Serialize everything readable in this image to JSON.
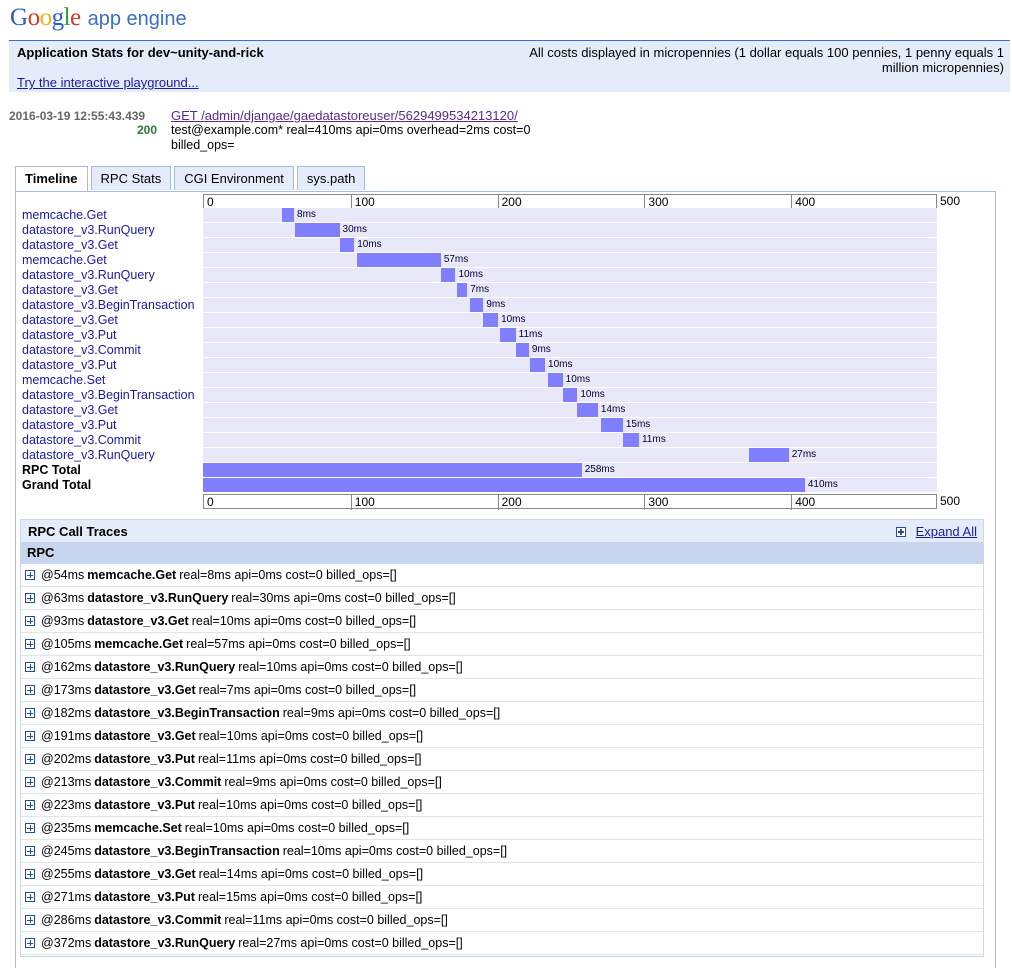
{
  "brand": {
    "google": [
      "G",
      "o",
      "o",
      "g",
      "l",
      "e"
    ],
    "product": "app engine"
  },
  "header": {
    "title": "Application Stats for dev~unity-and-rick",
    "cost_note": "All costs displayed in micropennies (1 dollar equals 100 pennies, 1 penny equals 1 million micropennies)",
    "playground_link": "Try the interactive playground..."
  },
  "request": {
    "timestamp": "2016-03-19 12:55:43.439",
    "status": "200",
    "link": "GET /admin/djangae/gaedatastoreuser/5629499534213120/",
    "details": "test@example.com* real=410ms api=0ms overhead=2ms cost=0 billed_ops="
  },
  "tabs": [
    "Timeline",
    "RPC Stats",
    "CGI Environment",
    "sys.path"
  ],
  "active_tab": 0,
  "timeline": {
    "scale_max": 500,
    "ticks": [
      "0",
      "100",
      "200",
      "300",
      "400"
    ],
    "end_label": "500",
    "rows": [
      {
        "name": "memcache.Get",
        "start": 54,
        "dur": 8,
        "label": "8ms"
      },
      {
        "name": "datastore_v3.RunQuery",
        "start": 63,
        "dur": 30,
        "label": "30ms"
      },
      {
        "name": "datastore_v3.Get",
        "start": 93,
        "dur": 10,
        "label": "10ms"
      },
      {
        "name": "memcache.Get",
        "start": 105,
        "dur": 57,
        "label": "57ms"
      },
      {
        "name": "datastore_v3.RunQuery",
        "start": 162,
        "dur": 10,
        "label": "10ms"
      },
      {
        "name": "datastore_v3.Get",
        "start": 173,
        "dur": 7,
        "label": "7ms"
      },
      {
        "name": "datastore_v3.BeginTransaction",
        "start": 182,
        "dur": 9,
        "label": "9ms"
      },
      {
        "name": "datastore_v3.Get",
        "start": 191,
        "dur": 10,
        "label": "10ms"
      },
      {
        "name": "datastore_v3.Put",
        "start": 202,
        "dur": 11,
        "label": "11ms"
      },
      {
        "name": "datastore_v3.Commit",
        "start": 213,
        "dur": 9,
        "label": "9ms"
      },
      {
        "name": "datastore_v3.Put",
        "start": 223,
        "dur": 10,
        "label": "10ms"
      },
      {
        "name": "memcache.Set",
        "start": 235,
        "dur": 10,
        "label": "10ms"
      },
      {
        "name": "datastore_v3.BeginTransaction",
        "start": 245,
        "dur": 10,
        "label": "10ms"
      },
      {
        "name": "datastore_v3.Get",
        "start": 255,
        "dur": 14,
        "label": "14ms"
      },
      {
        "name": "datastore_v3.Put",
        "start": 271,
        "dur": 15,
        "label": "15ms"
      },
      {
        "name": "datastore_v3.Commit",
        "start": 286,
        "dur": 11,
        "label": "11ms"
      },
      {
        "name": "datastore_v3.RunQuery",
        "start": 372,
        "dur": 27,
        "label": "27ms"
      }
    ],
    "totals": [
      {
        "name": "RPC Total",
        "start": 0,
        "dur": 258,
        "label": "258ms"
      },
      {
        "name": "Grand Total",
        "start": 0,
        "dur": 410,
        "label": "410ms"
      }
    ]
  },
  "traces": {
    "title": "RPC Call Traces",
    "expand_all": "Expand All",
    "column": "RPC",
    "rows": [
      {
        "at": "@54ms",
        "name": "memcache.Get",
        "stats": "real=8ms api=0ms cost=0 billed_ops=[]"
      },
      {
        "at": "@63ms",
        "name": "datastore_v3.RunQuery",
        "stats": "real=30ms api=0ms cost=0 billed_ops=[]"
      },
      {
        "at": "@93ms",
        "name": "datastore_v3.Get",
        "stats": "real=10ms api=0ms cost=0 billed_ops=[]"
      },
      {
        "at": "@105ms",
        "name": "memcache.Get",
        "stats": "real=57ms api=0ms cost=0 billed_ops=[]"
      },
      {
        "at": "@162ms",
        "name": "datastore_v3.RunQuery",
        "stats": "real=10ms api=0ms cost=0 billed_ops=[]"
      },
      {
        "at": "@173ms",
        "name": "datastore_v3.Get",
        "stats": "real=7ms api=0ms cost=0 billed_ops=[]"
      },
      {
        "at": "@182ms",
        "name": "datastore_v3.BeginTransaction",
        "stats": "real=9ms api=0ms cost=0 billed_ops=[]"
      },
      {
        "at": "@191ms",
        "name": "datastore_v3.Get",
        "stats": "real=10ms api=0ms cost=0 billed_ops=[]"
      },
      {
        "at": "@202ms",
        "name": "datastore_v3.Put",
        "stats": "real=11ms api=0ms cost=0 billed_ops=[]"
      },
      {
        "at": "@213ms",
        "name": "datastore_v3.Commit",
        "stats": "real=9ms api=0ms cost=0 billed_ops=[]"
      },
      {
        "at": "@223ms",
        "name": "datastore_v3.Put",
        "stats": "real=10ms api=0ms cost=0 billed_ops=[]"
      },
      {
        "at": "@235ms",
        "name": "memcache.Set",
        "stats": "real=10ms api=0ms cost=0 billed_ops=[]"
      },
      {
        "at": "@245ms",
        "name": "datastore_v3.BeginTransaction",
        "stats": "real=10ms api=0ms cost=0 billed_ops=[]"
      },
      {
        "at": "@255ms",
        "name": "datastore_v3.Get",
        "stats": "real=14ms api=0ms cost=0 billed_ops=[]"
      },
      {
        "at": "@271ms",
        "name": "datastore_v3.Put",
        "stats": "real=15ms api=0ms cost=0 billed_ops=[]"
      },
      {
        "at": "@286ms",
        "name": "datastore_v3.Commit",
        "stats": "real=11ms api=0ms cost=0 billed_ops=[]"
      },
      {
        "at": "@372ms",
        "name": "datastore_v3.RunQuery",
        "stats": "real=27ms api=0ms cost=0 billed_ops=[]"
      }
    ]
  },
  "colors": {
    "bar": "#7f7fff",
    "track": "#e8e8f8",
    "header_bg": "#e5ecf9",
    "link": "#1a1aa6"
  }
}
